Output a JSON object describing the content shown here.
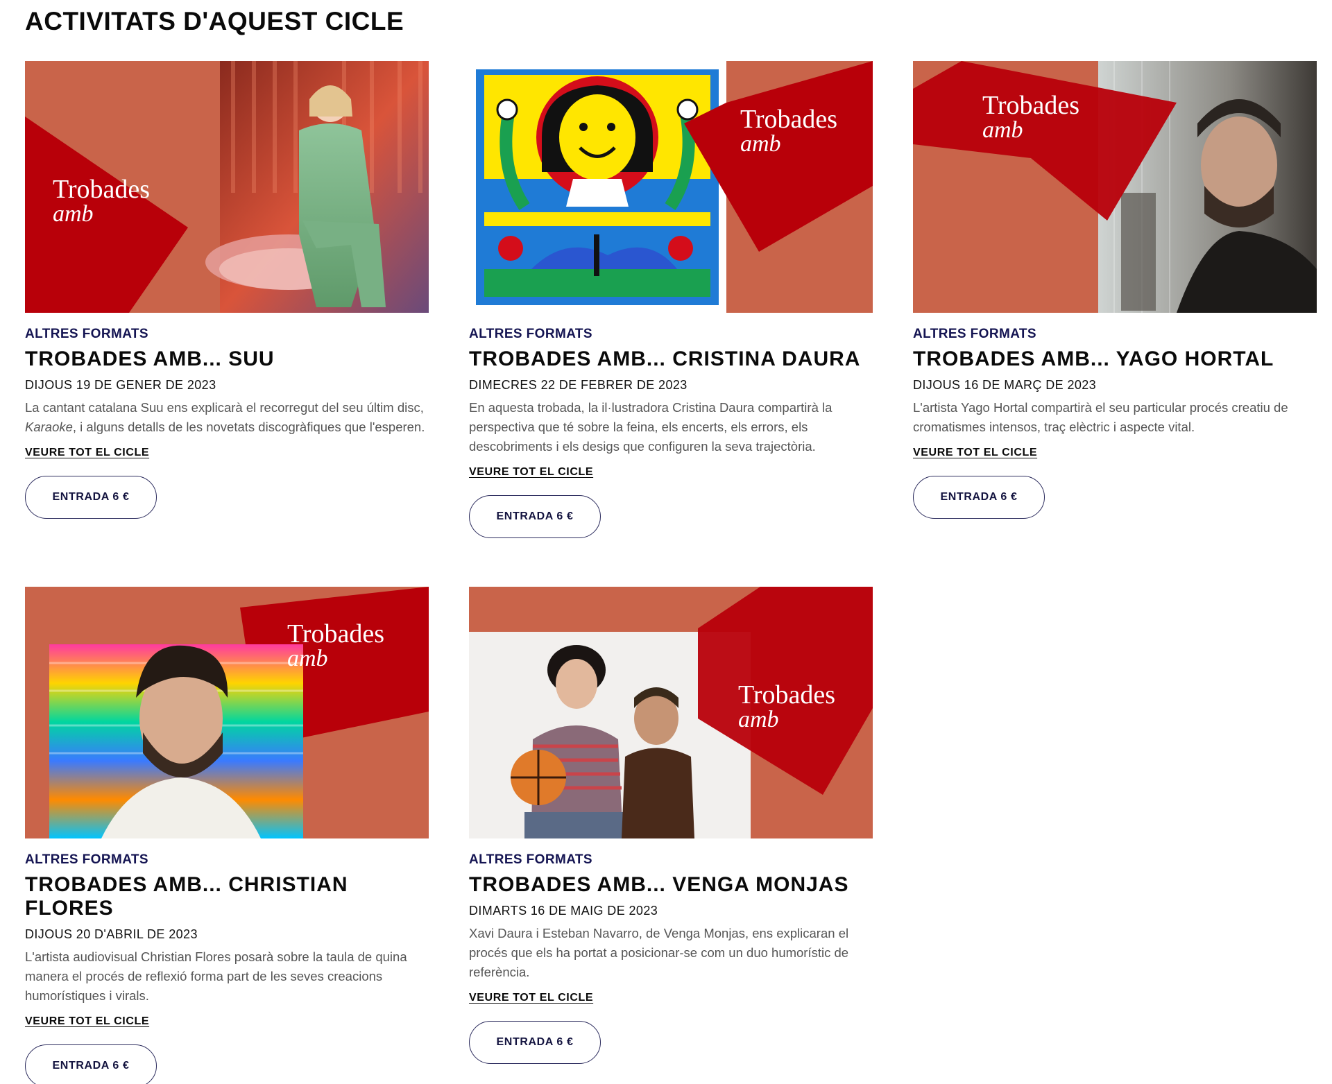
{
  "section": {
    "title": "ACTIVITATS D'AQUEST CICLE"
  },
  "brand": {
    "line1": "Trobades",
    "line2": "amb"
  },
  "colors": {
    "terracotta": "#c9644a",
    "red": "#b80009",
    "navy": "#141452"
  },
  "cards": [
    {
      "category": "ALTRES FORMATS",
      "title": "TROBADES AMB... SUU",
      "date": "DIJOUS 19 DE GENER DE 2023",
      "desc_before": "La cantant catalana Suu ens explicarà el recorregut del seu últim disc, ",
      "desc_em": "Karaoke",
      "desc_after": ", i alguns detalls de les novetats discogràfiques que l'esperen.",
      "link": "VEURE TOT EL CICLE",
      "button": "ENTRADA 6 €"
    },
    {
      "category": "ALTRES FORMATS",
      "title": "TROBADES AMB... CRISTINA DAURA",
      "date": "DIMECRES 22 DE FEBRER DE 2023",
      "desc": "En aquesta trobada, la il·lustradora Cristina Daura compartirà la perspectiva que té sobre la feina, els encerts, els errors, els descobriments i els desigs que configuren la seva trajectòria.",
      "link": "VEURE TOT EL CICLE",
      "button": "ENTRADA 6 €"
    },
    {
      "category": "ALTRES FORMATS",
      "title": "TROBADES AMB... YAGO HORTAL",
      "date": "DIJOUS 16 DE MARÇ DE 2023",
      "desc": "L'artista Yago Hortal compartirà el seu particular procés creatiu de cromatismes intensos, traç elèctric i aspecte vital.",
      "link": "VEURE TOT EL CICLE",
      "button": "ENTRADA 6 €"
    },
    {
      "category": "ALTRES FORMATS",
      "title": "TROBADES AMB... CHRISTIAN FLORES",
      "date": "DIJOUS 20 D'ABRIL DE 2023",
      "desc": "L'artista audiovisual Christian Flores posarà sobre la taula de quina manera el procés de reflexió forma part de les seves creacions humorístiques i virals.",
      "link": "VEURE TOT EL CICLE",
      "button": "ENTRADA 6 €"
    },
    {
      "category": "ALTRES FORMATS",
      "title": "TROBADES AMB... VENGA MONJAS",
      "date": "DIMARTS 16 DE MAIG DE 2023",
      "desc": "Xavi Daura i Esteban Navarro, de Venga Monjas, ens explicaran el procés que els ha portat a posicionar-se com un duo humorístic de referència.",
      "link": "VEURE TOT EL CICLE",
      "button": "ENTRADA 6 €"
    }
  ]
}
